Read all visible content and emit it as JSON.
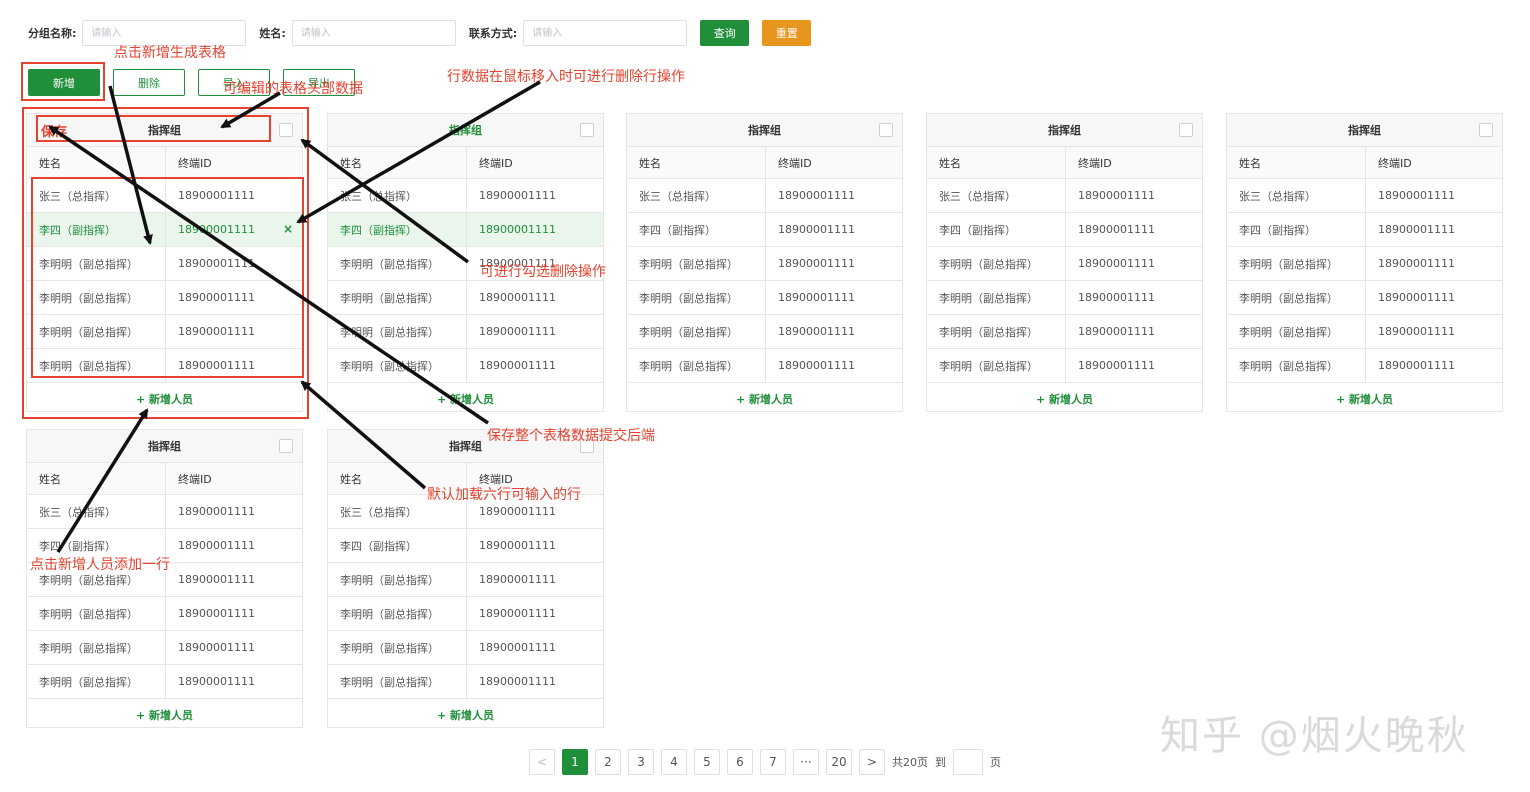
{
  "search": {
    "group_label": "分组名称:",
    "group_placeholder": "请输入",
    "name_label": "姓名:",
    "name_placeholder": "请输入",
    "contact_label": "联系方式:",
    "contact_placeholder": "请输入",
    "query_label": "查询",
    "reset_label": "重置"
  },
  "toolbar": {
    "add_label": "新增",
    "delete_label": "删除",
    "import_label": "导入",
    "export_label": "导出"
  },
  "card": {
    "title": "指挥组",
    "save_label": "保存",
    "col_name": "姓名",
    "col_terminal": "终端ID",
    "add_member_label": "+ 新增人员",
    "rows": [
      {
        "name": "张三（总指挥）",
        "terminal": "18900001111"
      },
      {
        "name": "李四（副指挥）",
        "terminal": "18900001111"
      },
      {
        "name": "李明明（副总指挥）",
        "terminal": "18900001111"
      },
      {
        "name": "李明明（副总指挥）",
        "terminal": "18900001111"
      },
      {
        "name": "李明明（副总指挥）",
        "terminal": "18900001111"
      },
      {
        "name": "李明明（副总指挥）",
        "terminal": "18900001111"
      }
    ],
    "delete_row_icon": "×"
  },
  "pagination": {
    "prev": "<",
    "pages": [
      "1",
      "2",
      "3",
      "4",
      "5",
      "6",
      "7"
    ],
    "ellipsis": "···",
    "last": "20",
    "next": ">",
    "total_text": "共20页",
    "goto_text": "到",
    "page_unit": "页",
    "current": 1
  },
  "annotations": {
    "add_generates_table": "点击新增生成表格",
    "editable_header": "可编辑的表格头部数据",
    "row_hover_delete": "行数据在鼠标移入时可进行删除行操作",
    "checkbox_delete": "可进行勾选删除操作",
    "save_submit": "保存整个表格数据提交后端",
    "default_six_rows": "默认加载六行可输入的行",
    "add_member_row": "点击新增人员添加一行"
  },
  "watermark": "知乎 @烟火晚秋",
  "colors": {
    "primary_green": "#1f8f3a",
    "reset_orange": "#e8951e",
    "annotation_red": "#e5432f"
  }
}
